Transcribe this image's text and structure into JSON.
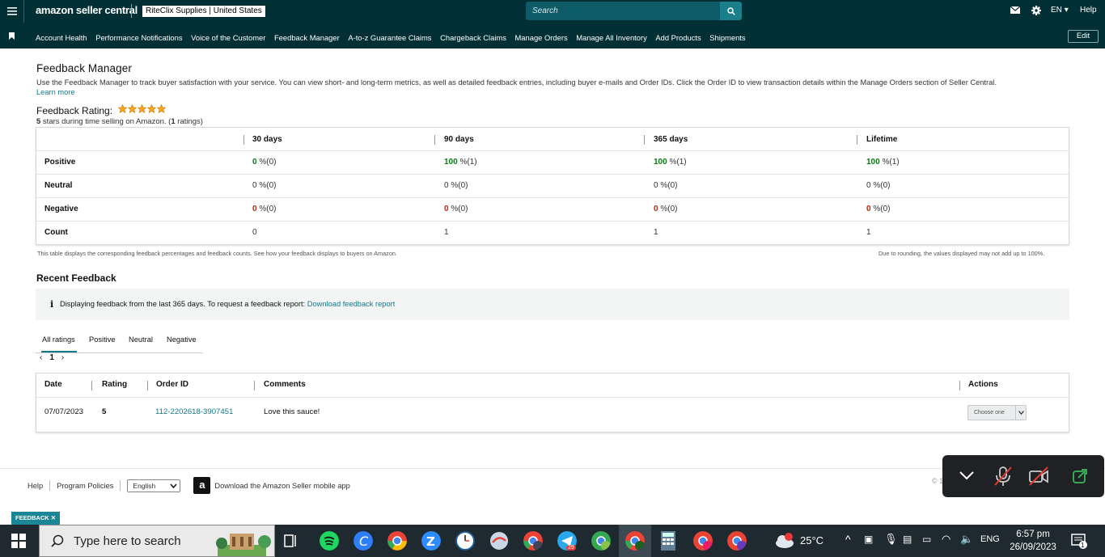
{
  "header": {
    "logo_text": "amazon seller central",
    "store_label": "RiteClix Supplies | United States",
    "search_placeholder": "Search",
    "language": "EN",
    "help": "Help",
    "edit": "Edit",
    "nav": [
      "Account Health",
      "Performance Notifications",
      "Voice of the Customer",
      "Feedback Manager",
      "A-to-z Guarantee Claims",
      "Chargeback Claims",
      "Manage Orders",
      "Manage All Inventory",
      "Add Products",
      "Shipments"
    ]
  },
  "page": {
    "title": "Feedback Manager",
    "description": "Use the Feedback Manager to track buyer satisfaction with your service. You can view short- and long-term metrics, as well as detailed feedback entries, including buyer e-mails and Order IDs. Click the Order ID to view transaction details within the Manage Orders section of Seller Central.",
    "learn_more": "Learn more",
    "rating_label": "Feedback Rating:",
    "rating_stars": 5,
    "rating_sub_bold1": "5",
    "rating_sub_mid": " stars during time selling on Amazon. (",
    "rating_sub_bold2": "1",
    "rating_sub_end": " ratings)"
  },
  "metrics": {
    "columns": [
      "30 days",
      "90 days",
      "365 days",
      "Lifetime"
    ],
    "rows": [
      {
        "label": "Positive",
        "values": [
          [
            "0",
            " %(0)",
            "green"
          ],
          [
            "100",
            " %(1)",
            "green"
          ],
          [
            "100",
            " %(1)",
            "green"
          ],
          [
            "100",
            " %(1)",
            "green"
          ]
        ]
      },
      {
        "label": "Neutral",
        "values": [
          [
            "0",
            " %(0)",
            ""
          ],
          [
            "0",
            " %(0)",
            ""
          ],
          [
            "0",
            " %(0)",
            ""
          ],
          [
            "0",
            " %(0)",
            ""
          ]
        ]
      },
      {
        "label": "Negative",
        "values": [
          [
            "0",
            " %(0)",
            "red"
          ],
          [
            "0",
            " %(0)",
            "red"
          ],
          [
            "0",
            " %(0)",
            "red"
          ],
          [
            "0",
            " %(0)",
            "red"
          ]
        ]
      },
      {
        "label": "Count",
        "values": [
          [
            "0",
            "",
            ""
          ],
          [
            "1",
            "",
            ""
          ],
          [
            "1",
            "",
            ""
          ],
          [
            "1",
            "",
            ""
          ]
        ]
      }
    ],
    "note": "This table displays the corresponding feedback percentages and feedback counts. See how your feedback displays to buyers on Amazon.",
    "rounding_note": "Due to rounding, the values displayed may not add up to 100%."
  },
  "recent": {
    "title": "Recent Feedback",
    "info_text": "Displaying feedback from the last 365 days. To request a feedback report: ",
    "info_link": "Download feedback report",
    "tabs": [
      "All ratings",
      "Positive",
      "Neutral",
      "Negative"
    ],
    "page": "1",
    "columns": [
      "Date",
      "Rating",
      "Order ID",
      "Comments",
      "Actions"
    ],
    "rows": [
      {
        "date": "07/07/2023",
        "rating": "5",
        "order_id": "112-2202618-3907451",
        "comment": "Love this sauce!",
        "action": "Choose one"
      }
    ]
  },
  "footer": {
    "help": "Help",
    "policies": "Program Policies",
    "language": "English",
    "app_text": "Download the Amazon Seller mobile app",
    "copyright": "© 1"
  },
  "tag": "FEEDBACK",
  "taskbar": {
    "search": "Type here to search",
    "weather": "25°C",
    "lang": "ENG",
    "time": "6:57 pm",
    "date": "26/09/2023",
    "telegram_badge": "29",
    "notif_badge": "1",
    "weather_badge": "1"
  }
}
